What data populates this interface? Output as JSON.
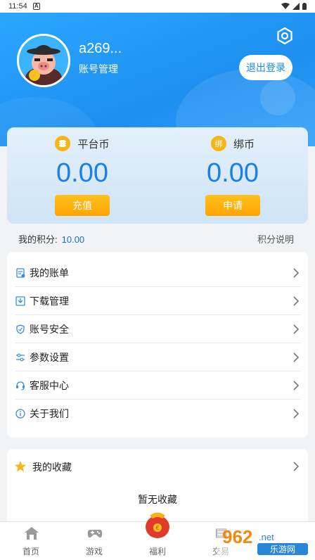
{
  "status": {
    "time": "11:54",
    "sim_label": "A"
  },
  "profile": {
    "username": "a269...",
    "account_manage": "账号管理",
    "logout": "退出登录"
  },
  "wallet": {
    "platform": {
      "title": "平台币",
      "amount": "0.00",
      "button": "充值"
    },
    "bound": {
      "title": "绑币",
      "badge": "绑",
      "amount": "0.00",
      "button": "申请"
    }
  },
  "points": {
    "label": "我的积分:",
    "value": "10.00",
    "help": "积分说明"
  },
  "menu": {
    "items": [
      {
        "label": "我的账单",
        "icon": "bill-icon"
      },
      {
        "label": "下载管理",
        "icon": "download-icon"
      },
      {
        "label": "账号安全",
        "icon": "shield-icon"
      },
      {
        "label": "参数设置",
        "icon": "sliders-icon"
      },
      {
        "label": "客服中心",
        "icon": "headset-icon"
      },
      {
        "label": "关于我们",
        "icon": "info-icon"
      }
    ]
  },
  "favorites": {
    "title": "我的收藏",
    "empty": "暂无收藏"
  },
  "tabs": [
    {
      "label": "首页",
      "icon": "home-icon"
    },
    {
      "label": "游戏",
      "icon": "gamepad-icon"
    },
    {
      "label": "福利",
      "icon": "gift-icon"
    },
    {
      "label": "交易",
      "icon": "trade-icon"
    }
  ],
  "watermark": {
    "brand": "962",
    "suffix": ".net",
    "site": "乐游网"
  },
  "colors": {
    "header": "#1e8ff0",
    "accent_text": "#1a7fe6",
    "button": "#ffa405",
    "coin": "#f4b516"
  }
}
